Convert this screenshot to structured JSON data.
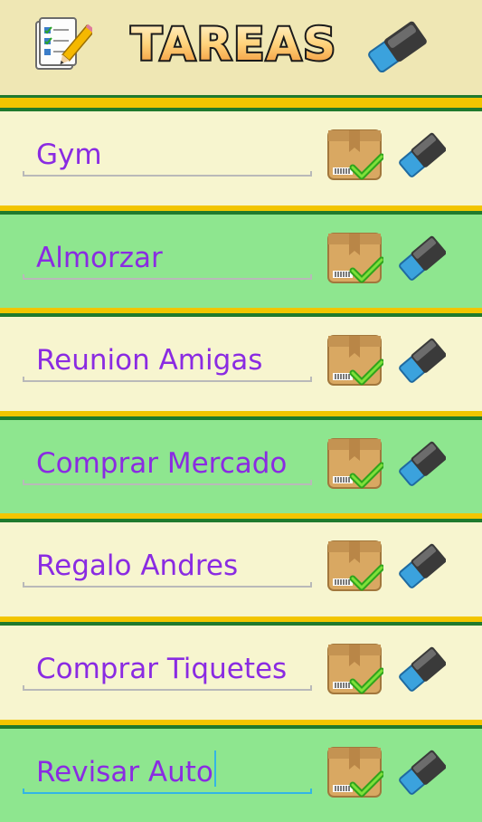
{
  "header": {
    "title": "TAREAS"
  },
  "tasks": [
    {
      "text": "Gym",
      "row": "light"
    },
    {
      "text": "Almorzar",
      "row": "green"
    },
    {
      "text": "Reunion Amigas",
      "row": "light"
    },
    {
      "text": "Comprar Mercado",
      "row": "green"
    },
    {
      "text": "Regalo Andres",
      "row": "light"
    },
    {
      "text": "Comprar Tiquetes",
      "row": "light"
    },
    {
      "text": "Revisar Auto",
      "row": "green",
      "focused": true
    }
  ],
  "colors": {
    "task_text": "#8a2be2",
    "light_row": "#f7f5cf",
    "green_row": "#8ee68f",
    "accent_yellow": "#f2c500",
    "accent_green": "#1f7a2e"
  }
}
